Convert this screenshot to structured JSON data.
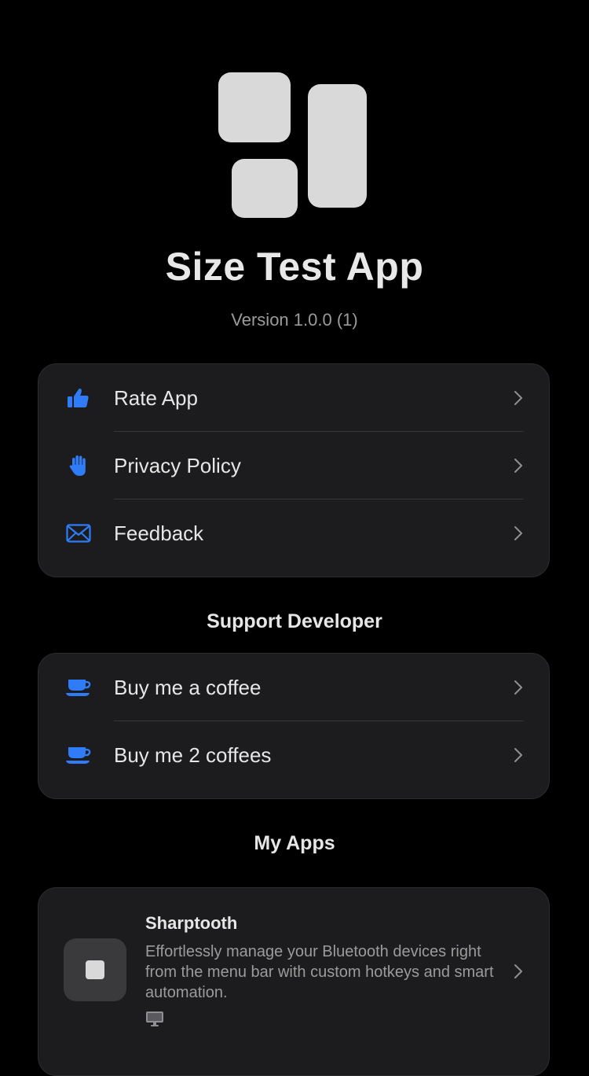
{
  "app": {
    "title": "Size Test App",
    "version": "Version 1.0.0 (1)"
  },
  "menu": {
    "items": [
      {
        "label": "Rate App",
        "icon": "thumbs-up-icon"
      },
      {
        "label": "Privacy Policy",
        "icon": "hand-raised-icon"
      },
      {
        "label": "Feedback",
        "icon": "envelope-icon"
      }
    ]
  },
  "support": {
    "title": "Support Developer",
    "items": [
      {
        "label": "Buy me a coffee",
        "icon": "coffee-cup-icon"
      },
      {
        "label": "Buy me 2 coffees",
        "icon": "coffee-cup-icon"
      }
    ]
  },
  "my_apps": {
    "title": "My Apps",
    "apps": [
      {
        "name": "Sharptooth",
        "description": "Effortlessly manage your Bluetooth devices right from the menu bar with custom hotkeys and smart automation.",
        "platform_icon": "desktop-computer-icon"
      }
    ]
  },
  "colors": {
    "background": "#000000",
    "card": "#1c1c1e",
    "accent": "#2f7cf6",
    "text": "#e6e6e6",
    "secondary_text": "#9b9b9b",
    "logo_tile": "#d9d9d9"
  }
}
